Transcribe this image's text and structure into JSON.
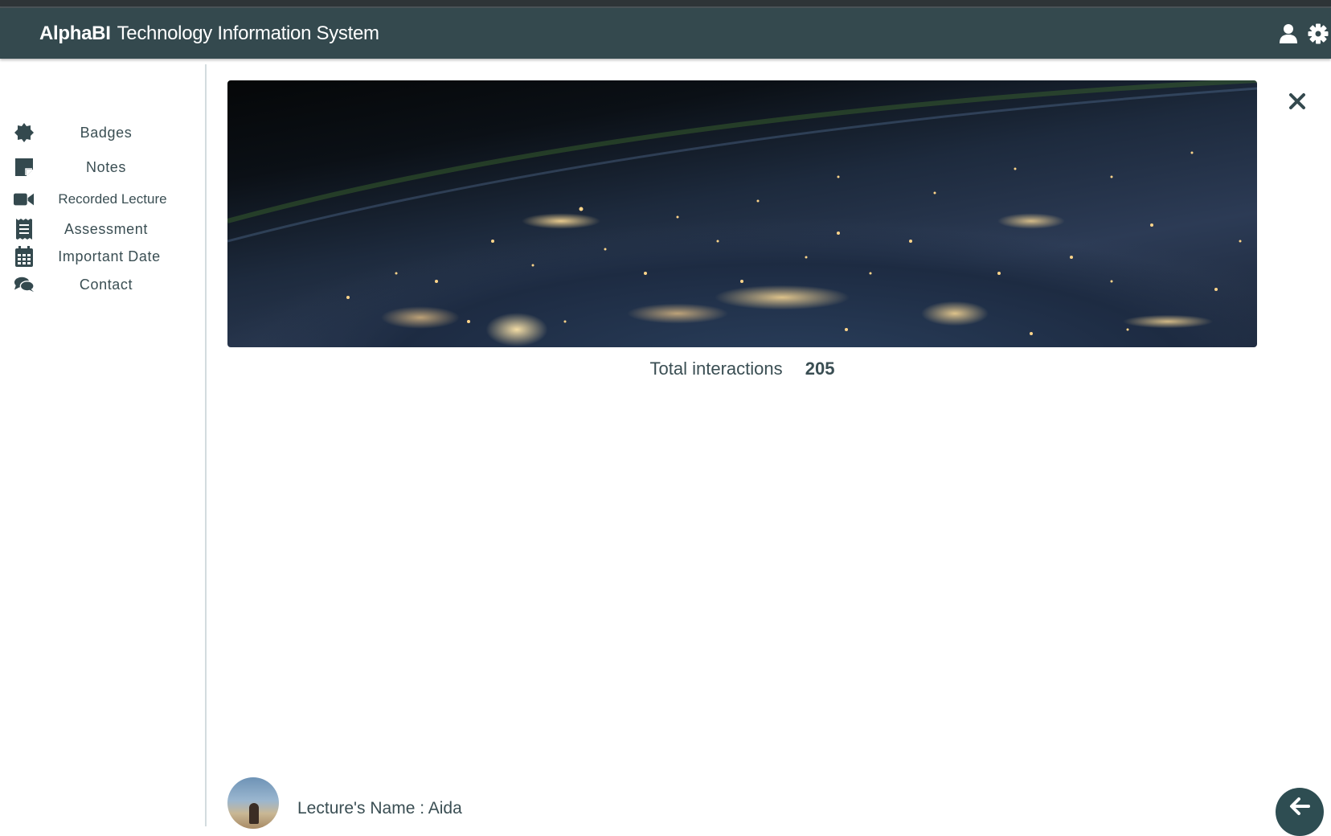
{
  "header": {
    "brand_name": "AlphaBI",
    "brand_subtitle": "Technology Information System",
    "icons": [
      "user-icon",
      "gear-icon"
    ]
  },
  "sidebar": {
    "items": [
      {
        "label": "Badges",
        "icon": "badge-icon"
      },
      {
        "label": "Notes",
        "icon": "sticky-note-icon"
      },
      {
        "label": "Recorded Lecture",
        "icon": "video-camera-icon"
      },
      {
        "label": "Assessment",
        "icon": "receipt-icon"
      },
      {
        "label": "Important Date",
        "icon": "calendar-icon"
      },
      {
        "label": "Contact",
        "icon": "comments-icon"
      }
    ]
  },
  "main": {
    "hero_image": "earth-at-night-image",
    "close_icon": "close-icon",
    "interactions_label": "Total interactions",
    "interactions_value": "205",
    "lecturer_label": "Lecture's Name : Aida",
    "back_icon": "arrow-left-icon"
  },
  "colors": {
    "header_bg": "#34494e",
    "text": "#3a4e53",
    "fab_bg": "#2e4d52",
    "divider": "#d3dcdf"
  }
}
